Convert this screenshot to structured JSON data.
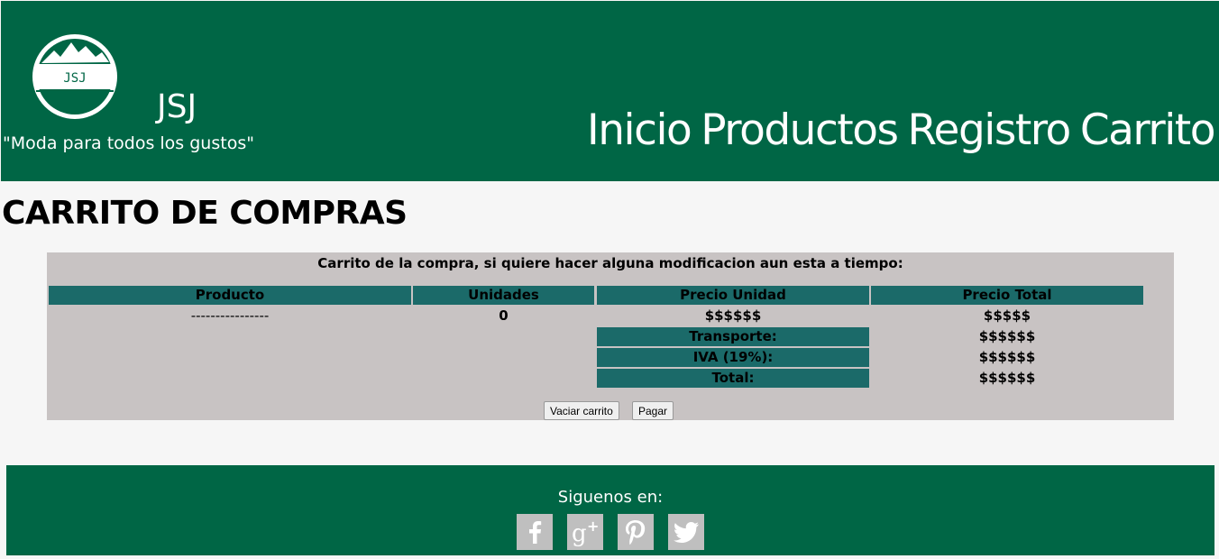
{
  "header": {
    "logo_text": "JSJ",
    "brand": "JSJ",
    "slogan": "\"Moda para todos los gustos\"",
    "nav": [
      "Inicio",
      "Productos",
      "Registro",
      "Carrito"
    ]
  },
  "page_title": "CARRITO DE COMPRAS",
  "cart": {
    "intro": "Carrito de la compra, si quiere hacer alguna modificacion aun esta a tiempo:",
    "columns": [
      "Producto",
      "Unidades",
      "Precio Unidad",
      "Precio Total"
    ],
    "row": {
      "product": "----------------",
      "units": "0",
      "unit_price": "$$$$$$",
      "total_price": "$$$$$"
    },
    "summary": [
      {
        "label": "Transporte:",
        "value": "$$$$$$"
      },
      {
        "label": "IVA (19%):",
        "value": "$$$$$$"
      },
      {
        "label": "Total:",
        "value": "$$$$$$"
      }
    ],
    "buttons": {
      "empty": "Vaciar carrito",
      "pay": "Pagar"
    }
  },
  "footer": {
    "label": "Siguenos en:",
    "social": [
      "facebook-icon",
      "google-plus-icon",
      "pinterest-icon",
      "twitter-icon"
    ]
  },
  "colors": {
    "brand_green": "#006645",
    "table_header": "#1b6a69",
    "cart_bg": "#c8c3c3",
    "social_bg": "#bfbfbf"
  }
}
